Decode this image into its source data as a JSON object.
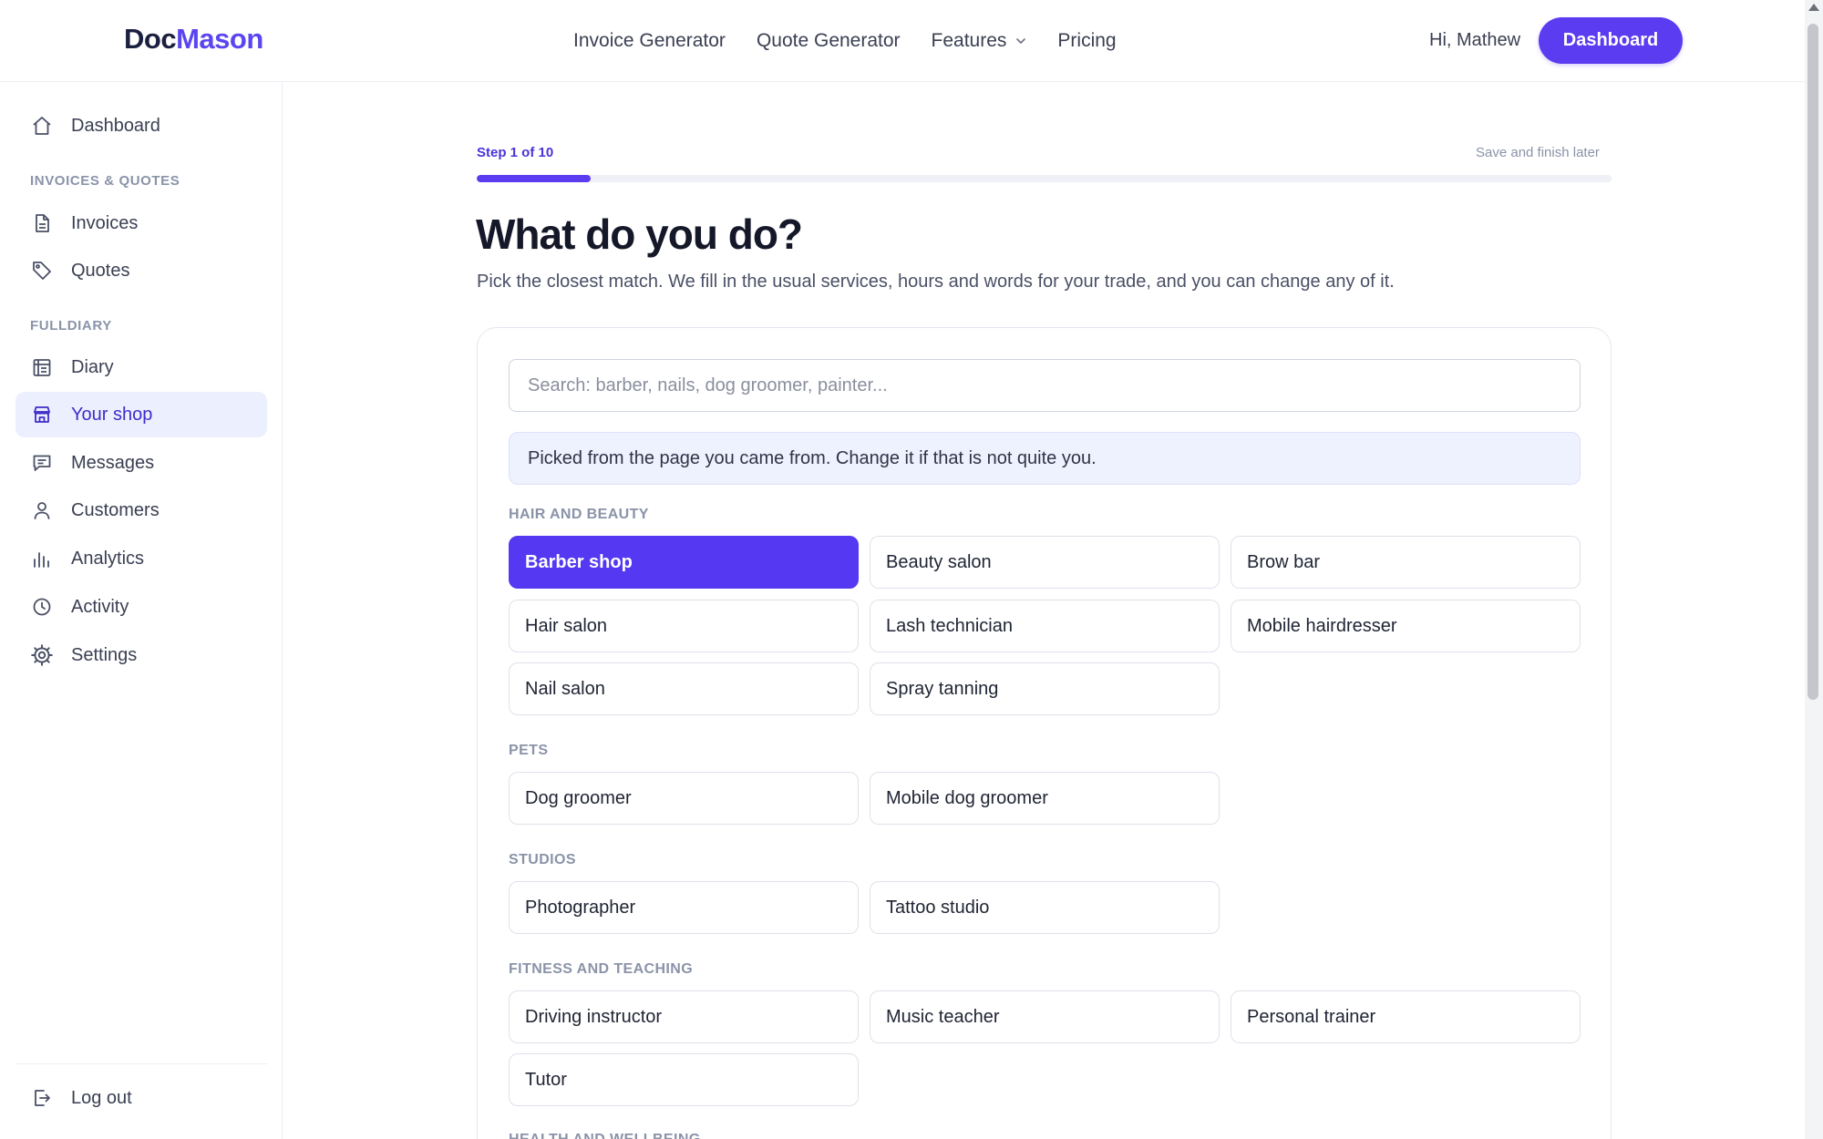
{
  "brand": {
    "part1": "Doc",
    "part2": "Mason"
  },
  "topnav": {
    "items": [
      {
        "label": "Invoice Generator"
      },
      {
        "label": "Quote Generator"
      },
      {
        "label": "Features",
        "dropdown": true
      },
      {
        "label": "Pricing"
      }
    ],
    "greeting": "Hi, Mathew",
    "dashboard_button": "Dashboard"
  },
  "sidebar": {
    "dashboard": {
      "label": "Dashboard",
      "icon": "home-icon"
    },
    "section_invoices": "INVOICES & QUOTES",
    "invoices": {
      "label": "Invoices",
      "icon": "document-icon"
    },
    "quotes": {
      "label": "Quotes",
      "icon": "tag-icon"
    },
    "section_fulldiary": "FULLDIARY",
    "diary": {
      "label": "Diary",
      "icon": "calendar-icon"
    },
    "your_shop": {
      "label": "Your shop",
      "icon": "store-icon",
      "active": true
    },
    "messages": {
      "label": "Messages",
      "icon": "chat-icon"
    },
    "customers": {
      "label": "Customers",
      "icon": "user-icon"
    },
    "analytics": {
      "label": "Analytics",
      "icon": "bar-chart-icon"
    },
    "activity": {
      "label": "Activity",
      "icon": "clock-icon"
    },
    "settings": {
      "label": "Settings",
      "icon": "gear-icon"
    },
    "logout": {
      "label": "Log out",
      "icon": "logout-icon"
    }
  },
  "wizard": {
    "step_label": "Step 1 of 10",
    "progress": 0.1,
    "save_later": "Save and finish later",
    "title": "What do you do?",
    "subtitle": "Pick the closest match. We fill in the usual services, hours and words for your trade, and you can change any of it.",
    "search_placeholder": "Search: barber, nails, dog groomer, painter...",
    "notice": "Picked from the page you came from. Change it if that is not quite you."
  },
  "groups": {
    "hair_beauty": {
      "title": "HAIR AND BEAUTY",
      "options": [
        "Barber shop",
        "Beauty salon",
        "Brow bar",
        "Hair salon",
        "Lash technician",
        "Mobile hairdresser",
        "Nail salon",
        "Spray tanning"
      ],
      "selected": "Barber shop"
    },
    "pets": {
      "title": "PETS",
      "options": [
        "Dog groomer",
        "Mobile dog groomer"
      ]
    },
    "studios": {
      "title": "STUDIOS",
      "options": [
        "Photographer",
        "Tattoo studio"
      ]
    },
    "fitness": {
      "title": "FITNESS AND TEACHING",
      "options": [
        "Driving instructor",
        "Music teacher",
        "Personal trainer",
        "Tutor"
      ]
    },
    "health": {
      "title": "HEALTH AND WELLBEING"
    }
  },
  "colors": {
    "accent": "#5b3cf0",
    "active_bg": "#eceffe",
    "muted": "#8a93a8"
  }
}
